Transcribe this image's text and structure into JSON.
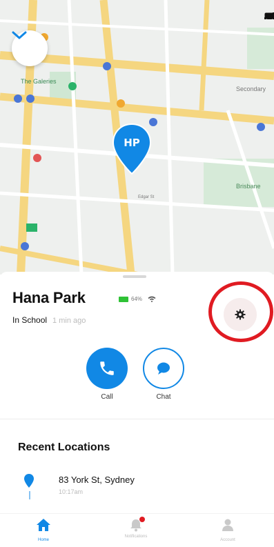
{
  "map": {
    "labels": [
      {
        "text": "The Galeries"
      },
      {
        "text": "Secondary"
      },
      {
        "text": "Brisbane"
      },
      {
        "text": "Edgar St"
      }
    ],
    "avatar_initials": "HP"
  },
  "profile": {
    "name": "Hana Park",
    "battery_percent": "64%",
    "status": "In School",
    "last_seen": "1 min ago"
  },
  "actions": {
    "call_label": "Call",
    "chat_label": "Chat"
  },
  "recent": {
    "title": "Recent Locations",
    "items": [
      {
        "address": "83 York St, Sydney",
        "time": "10:17am"
      }
    ]
  },
  "tabs": [
    {
      "label": "Home",
      "icon": "home-icon"
    },
    {
      "label": "Notifications",
      "icon": "bell-icon"
    },
    {
      "label": "Account",
      "icon": "person-icon"
    }
  ],
  "colors": {
    "accent": "#1188e5",
    "highlight": "#e01b22",
    "battery": "#2fc236"
  }
}
